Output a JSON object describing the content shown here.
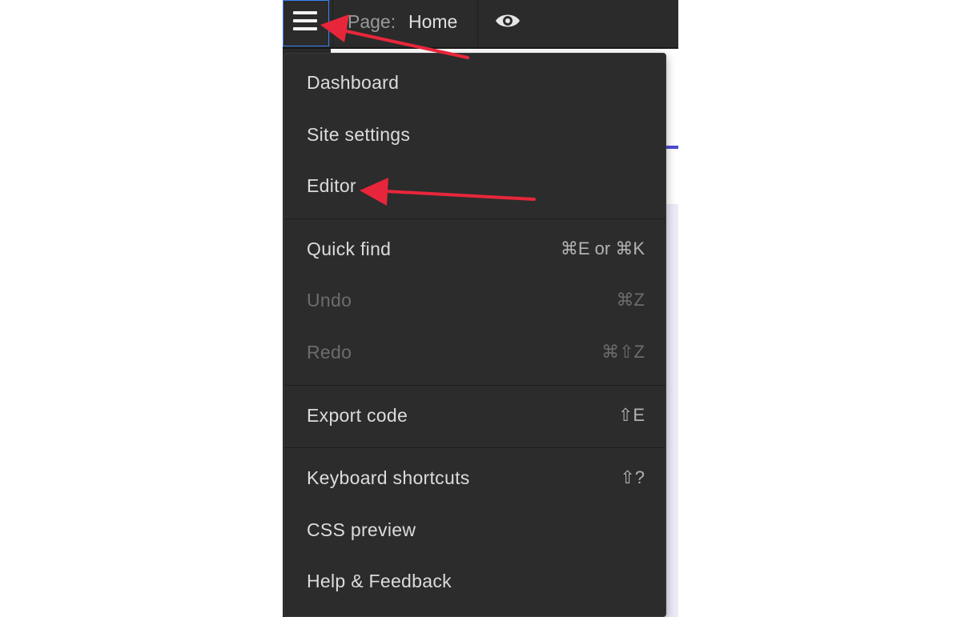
{
  "topbar": {
    "menu_icon": "hamburger-menu-icon",
    "page_label": "Page:",
    "page_name": "Home",
    "preview_icon": "eye-preview-icon"
  },
  "menu": {
    "groups": [
      {
        "items": [
          {
            "label": "Dashboard",
            "shortcut": "",
            "disabled": false
          },
          {
            "label": "Site settings",
            "shortcut": "",
            "disabled": false
          },
          {
            "label": "Editor",
            "shortcut": "",
            "disabled": false
          }
        ]
      },
      {
        "items": [
          {
            "label": "Quick find",
            "shortcut": "⌘E or ⌘K",
            "disabled": false
          },
          {
            "label": "Undo",
            "shortcut": "⌘Z",
            "disabled": true
          },
          {
            "label": "Redo",
            "shortcut": "⌘⇧Z",
            "disabled": true
          }
        ]
      },
      {
        "items": [
          {
            "label": "Export code",
            "shortcut": "⇧E",
            "disabled": false
          }
        ]
      },
      {
        "items": [
          {
            "label": "Keyboard shortcuts",
            "shortcut": "⇧?",
            "disabled": false
          },
          {
            "label": "CSS preview",
            "shortcut": "",
            "disabled": false
          },
          {
            "label": "Help & Feedback",
            "shortcut": "",
            "disabled": false
          }
        ]
      }
    ]
  },
  "colors": {
    "menu_bg": "#2c2c2c",
    "topbar_bg": "#2b2b2b",
    "annotation_arrow": "#e8263b",
    "focus_border": "#3b82f6"
  }
}
